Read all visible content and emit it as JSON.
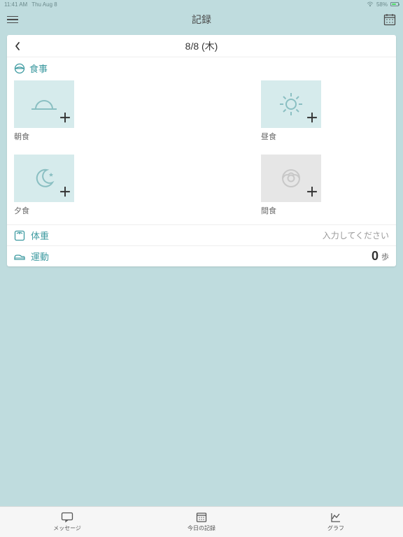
{
  "status": {
    "time": "11:41 AM",
    "date": "Thu Aug 8",
    "battery": "58%"
  },
  "nav": {
    "title": "記録"
  },
  "dateRow": {
    "text": "8/8 (木)"
  },
  "mealSection": {
    "label": "食事"
  },
  "meals": {
    "breakfast": "朝食",
    "lunch": "昼食",
    "dinner": "夕食",
    "snack": "間食"
  },
  "weight": {
    "label": "体重",
    "placeholder": "入力してください"
  },
  "exercise": {
    "label": "運動",
    "value": "0",
    "unit": "歩"
  },
  "tabs": {
    "messages": "メッセージ",
    "today": "今日の記録",
    "graph": "グラフ"
  }
}
